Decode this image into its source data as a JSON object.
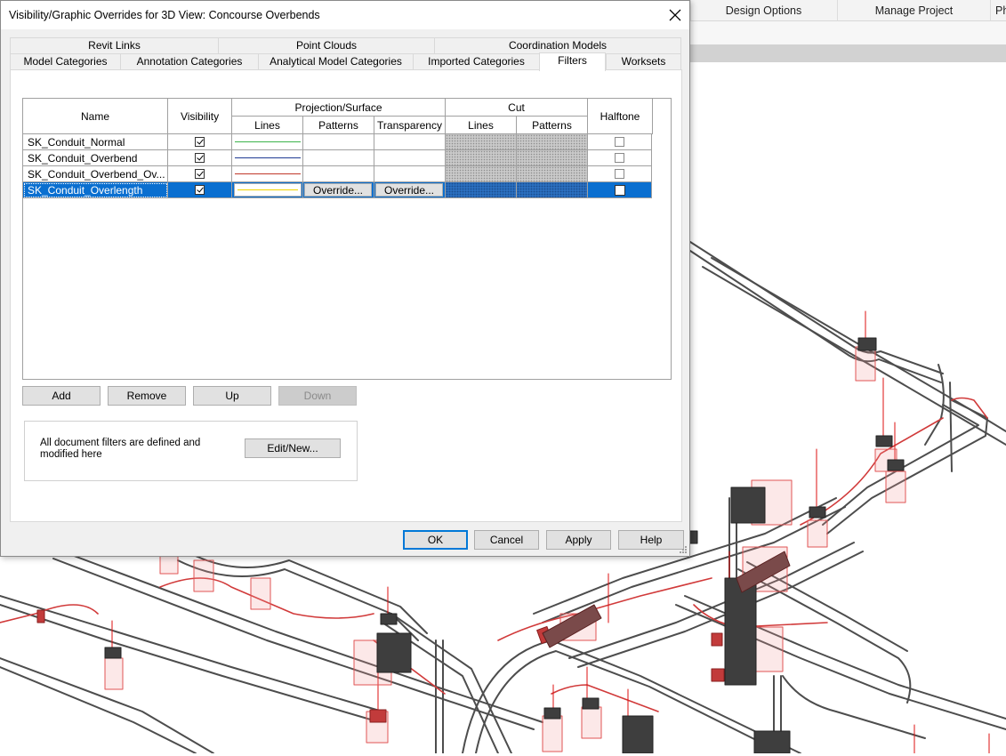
{
  "ribbon": {
    "tabs": [
      "Design Options",
      "Manage Project",
      "Ph"
    ]
  },
  "dialog": {
    "title": "Visibility/Graphic Overrides for 3D View: Concourse Overbends",
    "tabs_back_row": [
      "Revit Links",
      "Point Clouds",
      "Coordination Models"
    ],
    "tabs_front_row": [
      "Model Categories",
      "Annotation Categories",
      "Analytical Model Categories",
      "Imported Categories",
      "Filters",
      "Worksets"
    ],
    "active_tab": "Filters",
    "grid": {
      "headers": {
        "name": "Name",
        "visibility": "Visibility",
        "projection_surface": "Projection/Surface",
        "cut": "Cut",
        "halftone": "Halftone",
        "lines": "Lines",
        "patterns": "Patterns",
        "transparency": "Transparency",
        "cut_lines": "Lines",
        "cut_patterns": "Patterns"
      },
      "rows": [
        {
          "name": "SK_Conduit_Normal",
          "visible": true,
          "line_color": "#3cb44b",
          "halftone": false,
          "selected": false
        },
        {
          "name": "SK_Conduit_Overbend",
          "visible": true,
          "line_color": "#1f3a93",
          "halftone": false,
          "selected": false
        },
        {
          "name": "SK_Conduit_Overbend_Ov...",
          "visible": true,
          "line_color": "#c0392b",
          "halftone": false,
          "selected": false
        },
        {
          "name": "SK_Conduit_Overlength",
          "visible": true,
          "line_color": "#f1d300",
          "halftone": false,
          "selected": true
        }
      ],
      "override_label": "Override..."
    },
    "buttons": {
      "add": "Add",
      "remove": "Remove",
      "up": "Up",
      "down": "Down",
      "edit_new": "Edit/New...",
      "ok": "OK",
      "cancel": "Cancel",
      "apply": "Apply",
      "help": "Help"
    },
    "filter_info": "All document filters are defined and modified here"
  },
  "colors": {
    "selection": "#0a6fd0",
    "conduit": "#5a5a5a",
    "highlight": "#e02020"
  }
}
